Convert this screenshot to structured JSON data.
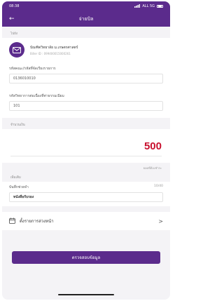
{
  "status": {
    "time": "08:38",
    "carrier": "ALL 5G"
  },
  "header": {
    "title": "จ่ายบิล",
    "back_icon": "arrow-left-icon"
  },
  "sender": {
    "section_label": "ไปยัง",
    "name": "บัณฑิตวิทยาลัย ม.เกษตรศาสตร์",
    "sub": "Biller ID : 099400015000261"
  },
  "ref1": {
    "label": "รหัสคณะ/รหัสที่จัดเรียงรายการ",
    "value": "0136010010"
  },
  "ref2": {
    "label": "รหัสวิทยาการต่อเนื่องที่ค่าธรรมเนียม",
    "value": "101"
  },
  "amount": {
    "label": "จำนวนเงิน",
    "value": "500",
    "hint": "ยอดที่ต้องชำระ"
  },
  "note": {
    "section_label": "เพิ่มเติม",
    "label": "บันทึกช่วยจำ",
    "counter": "10/40",
    "value": "หนังสือรับรอง"
  },
  "schedule": {
    "label": "ตั้งรายการล่วงหน้า",
    "icon": "calendar-icon",
    "chevron": ">"
  },
  "submit": {
    "label": "ตรวจสอบข้อมูล"
  }
}
